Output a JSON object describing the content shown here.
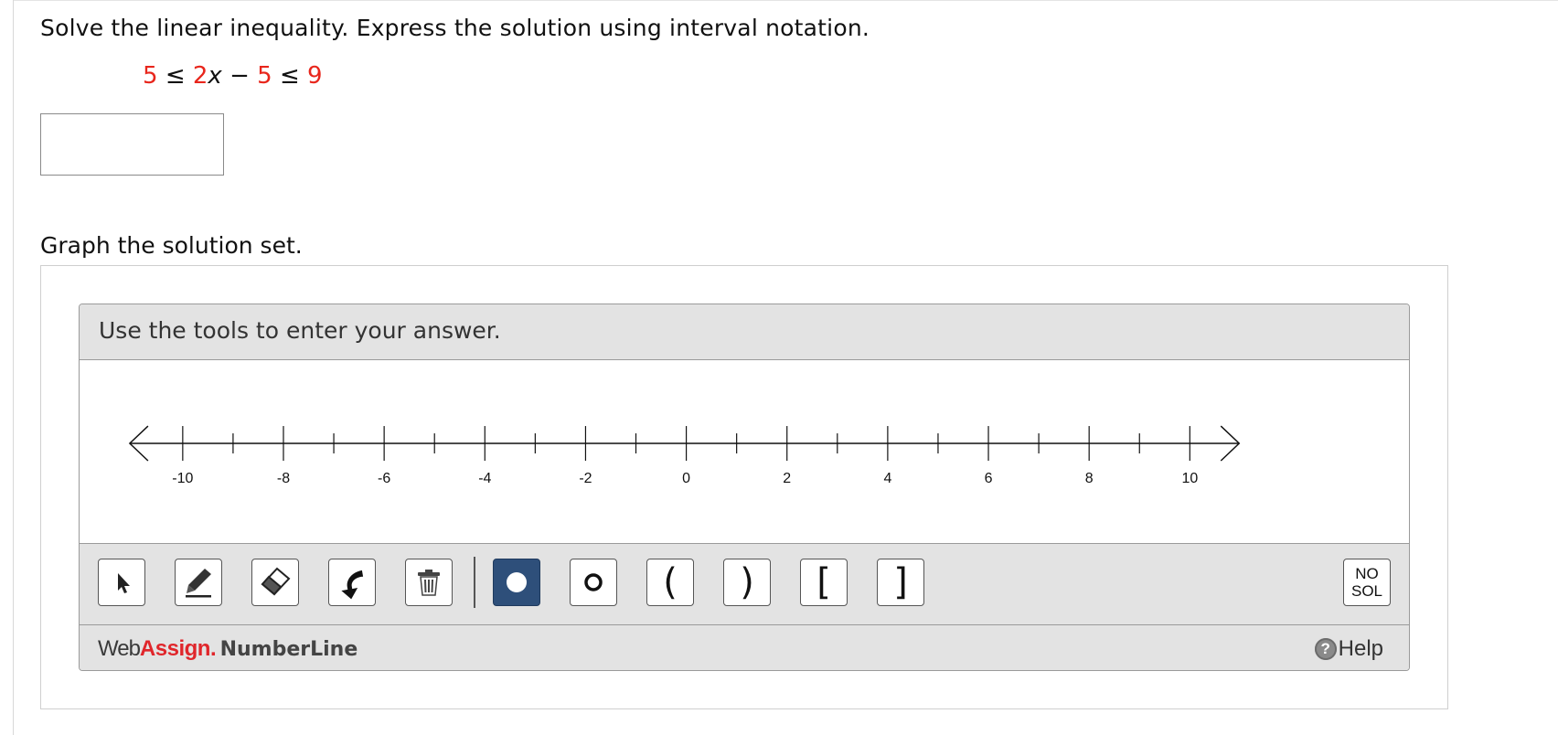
{
  "question": {
    "prompt": "Solve the linear inequality. Express the solution using interval notation.",
    "inequality": {
      "a": "5",
      "le1": "≤",
      "coef": "2",
      "var": "x",
      "minus": "−",
      "b": "5",
      "le2": "≤",
      "c": "9"
    },
    "answer_value": ""
  },
  "graph_prompt": "Graph the solution set.",
  "number_line": {
    "header": "Use the tools to enter your answer.",
    "tick_labels": [
      "-10",
      "-8",
      "-6",
      "-4",
      "-2",
      "0",
      "2",
      "4",
      "6",
      "8",
      "10"
    ],
    "min": -11,
    "max": 11,
    "tools": [
      {
        "name": "pointer-tool",
        "icon": "cursor-arrow-icon"
      },
      {
        "name": "pencil-tool",
        "icon": "pencil-icon"
      },
      {
        "name": "eraser-tool",
        "icon": "eraser-icon"
      },
      {
        "name": "undo-tool",
        "icon": "undo-arrow-icon"
      },
      {
        "name": "delete-tool",
        "icon": "trash-icon"
      },
      {
        "name": "closed-point-tool",
        "icon": "filled-circle-icon",
        "active": true
      },
      {
        "name": "open-point-tool",
        "icon": "open-circle-icon"
      },
      {
        "name": "left-paren-tool",
        "glyph": "("
      },
      {
        "name": "right-paren-tool",
        "glyph": ")"
      },
      {
        "name": "left-bracket-tool",
        "glyph": "["
      },
      {
        "name": "right-bracket-tool",
        "glyph": "]"
      }
    ],
    "no_solution": {
      "line1": "NO",
      "line2": "SOL"
    },
    "brand": {
      "web": "Web",
      "assign": "Assign",
      "dot": ".",
      "product": "NumberLine"
    },
    "help_label": "Help",
    "help_icon_glyph": "?",
    "active_color": "#2e4f7a",
    "accent_red": "#e8261c"
  }
}
